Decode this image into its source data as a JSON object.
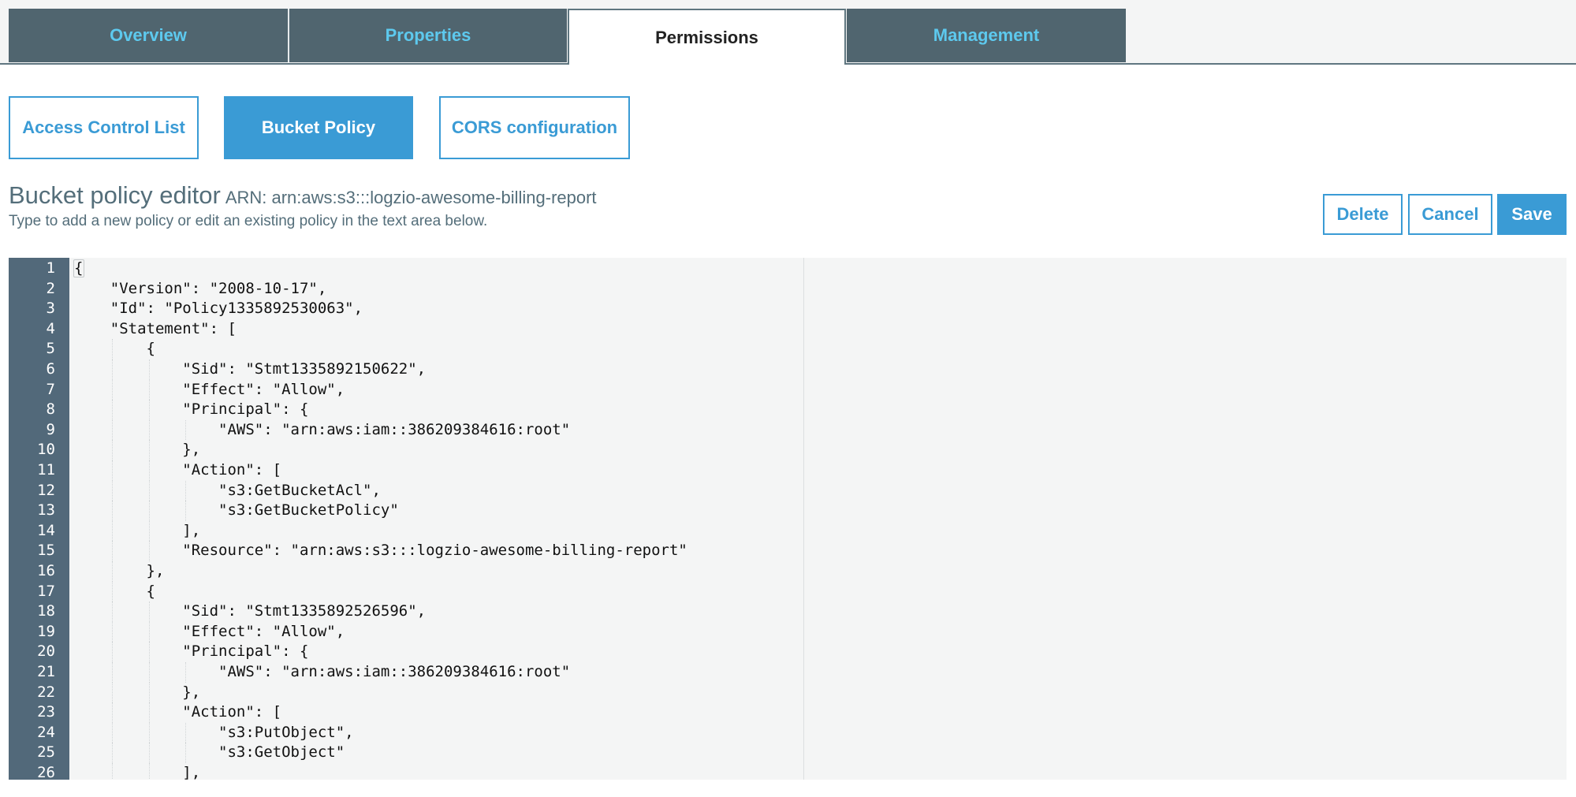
{
  "tabs": [
    {
      "label": "Overview",
      "active": false
    },
    {
      "label": "Properties",
      "active": false
    },
    {
      "label": "Permissions",
      "active": true
    },
    {
      "label": "Management",
      "active": false
    }
  ],
  "subtabs": [
    {
      "label": "Access Control List",
      "active": false
    },
    {
      "label": "Bucket Policy",
      "active": true
    },
    {
      "label": "CORS configuration",
      "active": false
    }
  ],
  "editor_header": {
    "title": "Bucket policy editor",
    "arn": "ARN: arn:aws:s3:::logzio-awesome-billing-report",
    "subtitle": "Type to add a new policy or edit an existing policy in the text area below."
  },
  "actions": {
    "delete": "Delete",
    "cancel": "Cancel",
    "save": "Save"
  },
  "colors": {
    "tab_bg": "#50656f",
    "tab_text": "#5dc9ee",
    "accent": "#3a9bd5",
    "heading": "#546e7a",
    "gutter": "#52697a"
  },
  "code": {
    "lines": [
      {
        "n": "1",
        "text": "{"
      },
      {
        "n": "2",
        "text": "    \"Version\": \"2008-10-17\","
      },
      {
        "n": "3",
        "text": "    \"Id\": \"Policy1335892530063\","
      },
      {
        "n": "4",
        "text": "    \"Statement\": ["
      },
      {
        "n": "5",
        "text": "        {"
      },
      {
        "n": "6",
        "text": "            \"Sid\": \"Stmt1335892150622\","
      },
      {
        "n": "7",
        "text": "            \"Effect\": \"Allow\","
      },
      {
        "n": "8",
        "text": "            \"Principal\": {"
      },
      {
        "n": "9",
        "text": "                \"AWS\": \"arn:aws:iam::386209384616:root\""
      },
      {
        "n": "10",
        "text": "            },"
      },
      {
        "n": "11",
        "text": "            \"Action\": ["
      },
      {
        "n": "12",
        "text": "                \"s3:GetBucketAcl\","
      },
      {
        "n": "13",
        "text": "                \"s3:GetBucketPolicy\""
      },
      {
        "n": "14",
        "text": "            ],"
      },
      {
        "n": "15",
        "text": "            \"Resource\": \"arn:aws:s3:::logzio-awesome-billing-report\""
      },
      {
        "n": "16",
        "text": "        },"
      },
      {
        "n": "17",
        "text": "        {"
      },
      {
        "n": "18",
        "text": "            \"Sid\": \"Stmt1335892526596\","
      },
      {
        "n": "19",
        "text": "            \"Effect\": \"Allow\","
      },
      {
        "n": "20",
        "text": "            \"Principal\": {"
      },
      {
        "n": "21",
        "text": "                \"AWS\": \"arn:aws:iam::386209384616:root\""
      },
      {
        "n": "22",
        "text": "            },"
      },
      {
        "n": "23",
        "text": "            \"Action\": ["
      },
      {
        "n": "24",
        "text": "                \"s3:PutObject\","
      },
      {
        "n": "25",
        "text": "                \"s3:GetObject\""
      },
      {
        "n": "26",
        "text": "            ],"
      }
    ]
  }
}
